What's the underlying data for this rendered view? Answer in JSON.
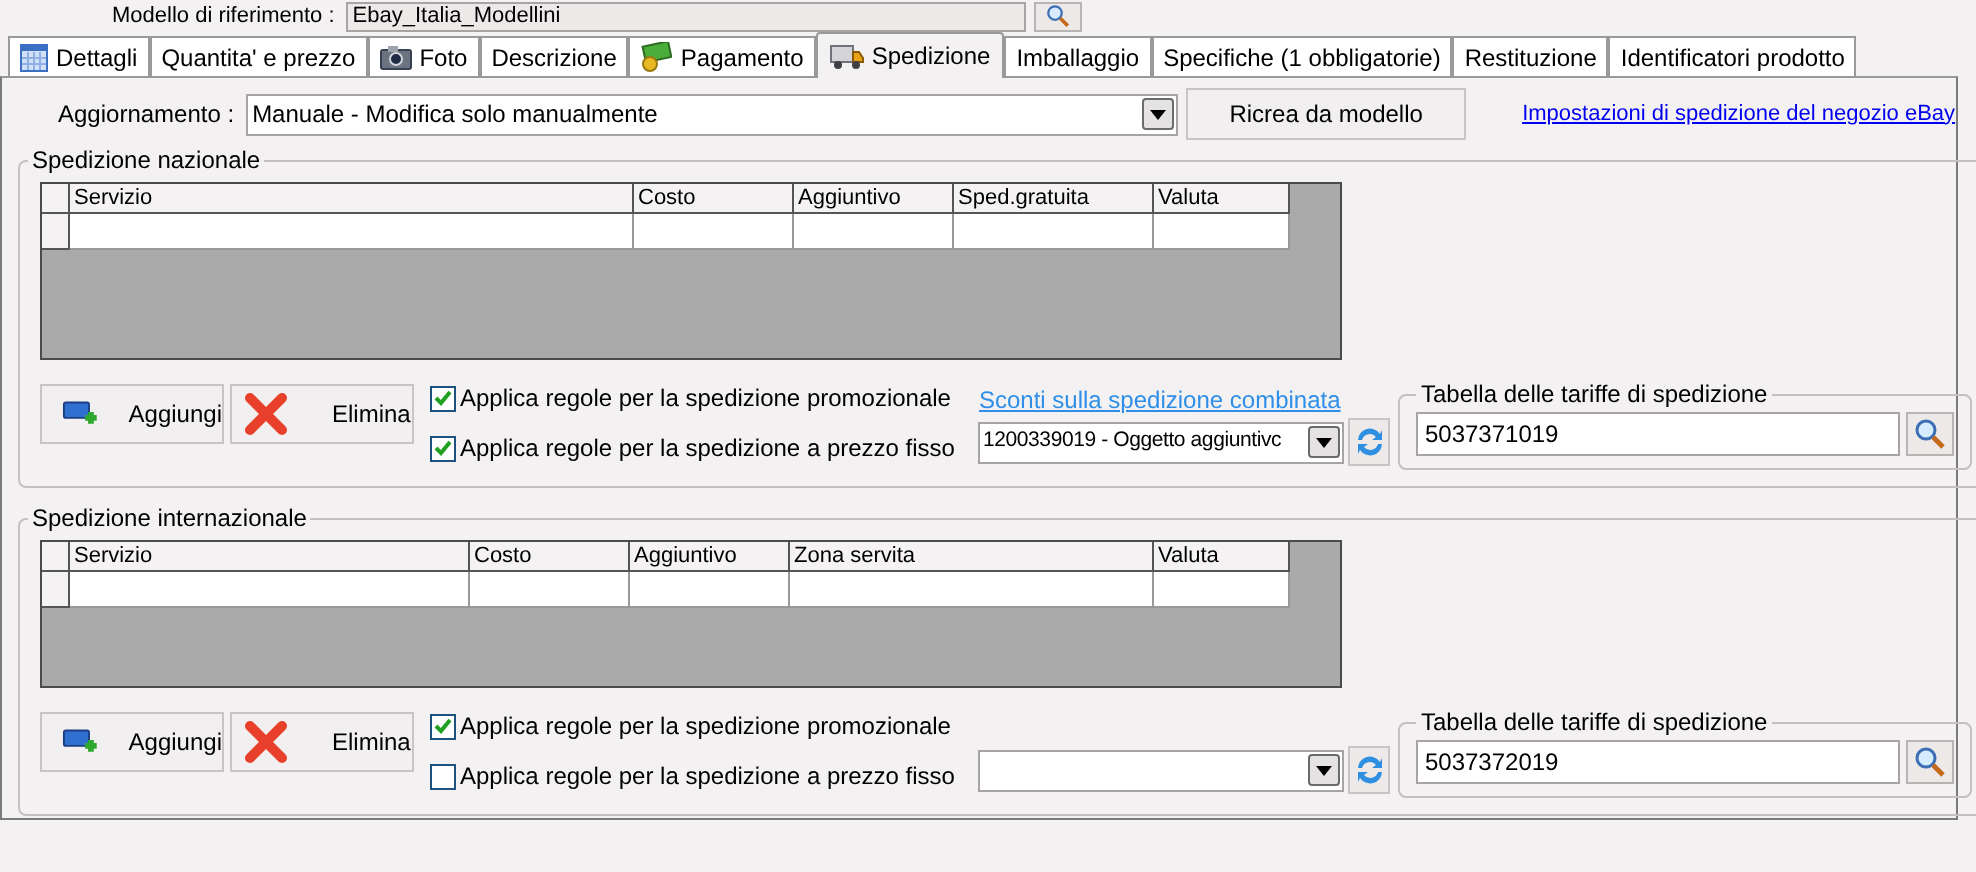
{
  "reference_model": {
    "label": "Modello di riferimento :",
    "value": "Ebay_Italia_Modellini"
  },
  "tabs": [
    {
      "label": "Dettagli",
      "selected": false
    },
    {
      "label": "Quantita' e prezzo",
      "selected": false
    },
    {
      "label": "Foto",
      "selected": false
    },
    {
      "label": "Descrizione",
      "selected": false
    },
    {
      "label": "Pagamento",
      "selected": false
    },
    {
      "label": "Spedizione",
      "selected": true
    },
    {
      "label": "Imballaggio",
      "selected": false
    },
    {
      "label": "Specifiche (1 obbligatorie)",
      "selected": false
    },
    {
      "label": "Restituzione",
      "selected": false
    },
    {
      "label": "Identificatori prodotto",
      "selected": false
    }
  ],
  "update": {
    "label": "Aggiornamento :",
    "value": "Manuale - Modifica solo manualmente",
    "button": "Ricrea da modello",
    "link": "Impostazioni di spedizione del negozio eBay"
  },
  "sections": [
    {
      "title": "Spedizione nazionale",
      "columns": [
        "Servizio",
        "Costo",
        "Aggiuntivo",
        "Sped.gratuita",
        "Valuta"
      ],
      "add": "Aggiungi",
      "remove": "Elimina",
      "checkboxes": [
        {
          "label": "Applica regole per la spedizione promozionale",
          "checked": true
        },
        {
          "label": "Applica regole per la spedizione a prezzo fisso",
          "checked": true
        }
      ],
      "link": "Sconti sulla spedizione combinata",
      "dropdown": "1200339019 - Oggetto aggiuntivc",
      "tariff": {
        "label": "Tabella delle tariffe di spedizione",
        "value": "5037371019"
      }
    },
    {
      "title": "Spedizione internazionale",
      "columns": [
        "Servizio",
        "Costo",
        "Aggiuntivo",
        "Zona servita",
        "Valuta"
      ],
      "add": "Aggiungi",
      "remove": "Elimina",
      "checkboxes": [
        {
          "label": "Applica regole per la spedizione promozionale",
          "checked": true
        },
        {
          "label": "Applica regole per la spedizione a prezzo fisso",
          "checked": false
        }
      ],
      "tariff": {
        "label": "Tabella delle tariffe di spedizione",
        "value": "5037372019"
      }
    }
  ]
}
